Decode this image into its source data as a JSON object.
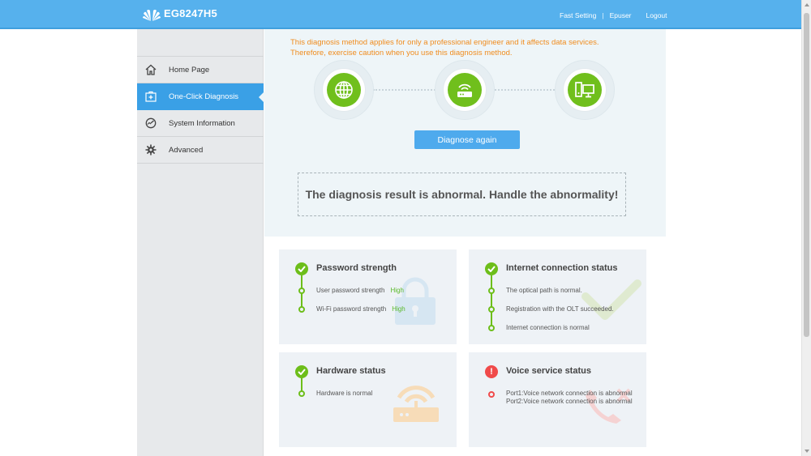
{
  "header": {
    "product": "EG8247H5",
    "links": [
      "Fast Setting",
      "Epuser",
      "Logout"
    ]
  },
  "sidebar": {
    "items": [
      {
        "label": "Home Page",
        "icon": "home-icon"
      },
      {
        "label": "One-Click Diagnosis",
        "icon": "diagnosis-icon"
      },
      {
        "label": "System Information",
        "icon": "dashboard-icon"
      },
      {
        "label": "Advanced",
        "icon": "gear-icon"
      }
    ],
    "active_index": 1
  },
  "diagnosis": {
    "warning_line1": "This diagnosis method applies for only a professional engineer and it affects data services.",
    "warning_line2": "Therefore, exercise caution when you use this diagnosis method.",
    "nodes": [
      "globe-icon",
      "router-icon",
      "computer-icon"
    ],
    "button_label": "Diagnose again",
    "result": "The diagnosis result is abnormal. Handle the abnormality!"
  },
  "cards": {
    "password": {
      "title": "Password strength",
      "status": "ok",
      "rows": [
        {
          "label": "User password strength",
          "value": "High"
        },
        {
          "label": "Wi-Fi password strength",
          "value": "High"
        }
      ]
    },
    "internet": {
      "title": "Internet connection status",
      "status": "ok",
      "rows": [
        "The optical path is normal.",
        "Registration with the OLT succeeded.",
        "Internet connection is normal"
      ]
    },
    "hardware": {
      "title": "Hardware status",
      "status": "ok",
      "rows": [
        "Hardware is normal"
      ]
    },
    "voice": {
      "title": "Voice service status",
      "status": "error",
      "status_symbol": "!",
      "rows": [
        "Port1:Voice network connection is abnormal",
        "Port2:Voice network connection is abnormal"
      ]
    }
  },
  "colors": {
    "header": "#56b1ed",
    "active_menu": "#3aa0e6",
    "ok": "#6dbe1a",
    "error": "#f04a4a",
    "warning_text": "#f08c1e"
  }
}
